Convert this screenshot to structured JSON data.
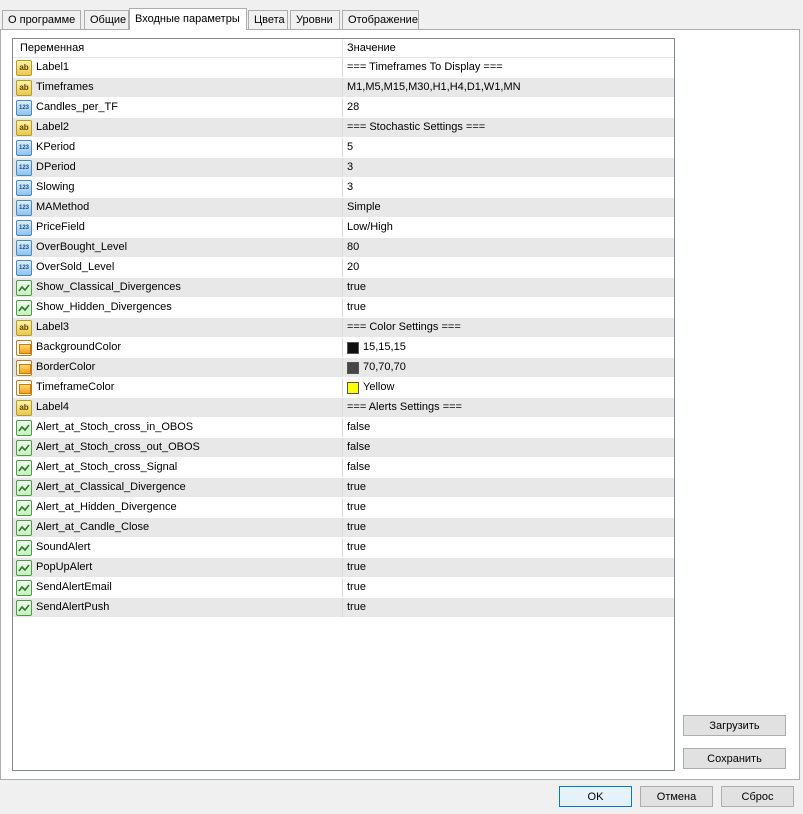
{
  "tabs": [
    {
      "label": "О программе"
    },
    {
      "label": "Общие"
    },
    {
      "label": "Входные параметры"
    },
    {
      "label": "Цвета"
    },
    {
      "label": "Уровни"
    },
    {
      "label": "Отображение"
    }
  ],
  "grid": {
    "header": {
      "variable": "Переменная",
      "value": "Значение"
    },
    "rows": [
      {
        "name": "Label1",
        "value": "=== Timeframes To Display ===",
        "icon": "ab"
      },
      {
        "name": "Timeframes",
        "value": "M1,M5,M15,M30,H1,H4,D1,W1,MN",
        "icon": "ab"
      },
      {
        "name": "Candles_per_TF",
        "value": "28",
        "icon": "num"
      },
      {
        "name": "Label2",
        "value": "=== Stochastic Settings ===",
        "icon": "ab"
      },
      {
        "name": "KPeriod",
        "value": "5",
        "icon": "num"
      },
      {
        "name": "DPeriod",
        "value": "3",
        "icon": "num"
      },
      {
        "name": "Slowing",
        "value": "3",
        "icon": "num"
      },
      {
        "name": "MAMethod",
        "value": "Simple",
        "icon": "num"
      },
      {
        "name": "PriceField",
        "value": "Low/High",
        "icon": "num"
      },
      {
        "name": "OverBought_Level",
        "value": "80",
        "icon": "num"
      },
      {
        "name": "OverSold_Level",
        "value": "20",
        "icon": "num"
      },
      {
        "name": "Show_Classical_Divergences",
        "value": "true",
        "icon": "bool"
      },
      {
        "name": "Show_Hidden_Divergences",
        "value": "true",
        "icon": "bool"
      },
      {
        "name": "Label3",
        "value": "=== Color Settings ===",
        "icon": "ab"
      },
      {
        "name": "BackgroundColor",
        "value": "15,15,15",
        "icon": "color",
        "swatch": "#0f0f0f"
      },
      {
        "name": "BorderColor",
        "value": "70,70,70",
        "icon": "color",
        "swatch": "#464646"
      },
      {
        "name": "TimeframeColor",
        "value": "Yellow",
        "icon": "color",
        "swatch": "#ffff00"
      },
      {
        "name": "Label4",
        "value": "=== Alerts Settings ===",
        "icon": "ab"
      },
      {
        "name": "Alert_at_Stoch_cross_in_OBOS",
        "value": "false",
        "icon": "bool"
      },
      {
        "name": "Alert_at_Stoch_cross_out_OBOS",
        "value": "false",
        "icon": "bool"
      },
      {
        "name": "Alert_at_Stoch_cross_Signal",
        "value": "false",
        "icon": "bool"
      },
      {
        "name": "Alert_at_Classical_Divergence",
        "value": "true",
        "icon": "bool"
      },
      {
        "name": "Alert_at_Hidden_Divergence",
        "value": "true",
        "icon": "bool"
      },
      {
        "name": "Alert_at_Candle_Close",
        "value": "true",
        "icon": "bool"
      },
      {
        "name": "SoundAlert",
        "value": "true",
        "icon": "bool"
      },
      {
        "name": "PopUpAlert",
        "value": "true",
        "icon": "bool"
      },
      {
        "name": "SendAlertEmail",
        "value": "true",
        "icon": "bool"
      },
      {
        "name": "SendAlertPush",
        "value": "true",
        "icon": "bool"
      }
    ]
  },
  "side_buttons": {
    "load": "Загрузить",
    "save": "Сохранить"
  },
  "footer_buttons": {
    "ok": "OK",
    "cancel": "Отмена",
    "reset": "Сброс"
  }
}
